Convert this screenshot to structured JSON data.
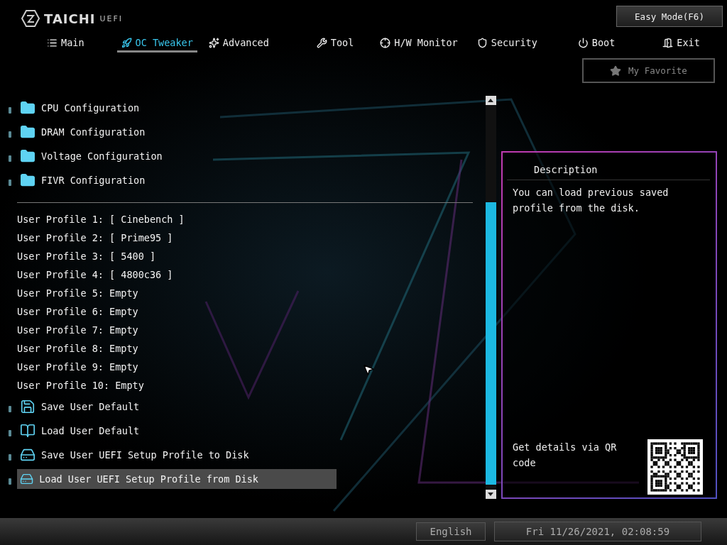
{
  "logo": {
    "brand": "TAICHI",
    "suffix": "UEFI"
  },
  "easy_mode_button": "Easy Mode(F6)",
  "tabs": [
    {
      "label": "Main",
      "kind": "list",
      "selected": false
    },
    {
      "label": "OC Tweaker",
      "kind": "rocket",
      "selected": true
    },
    {
      "label": "Advanced",
      "kind": "star",
      "selected": false
    },
    {
      "label": "Tool",
      "kind": "tools",
      "selected": false
    },
    {
      "label": "H/W Monitor",
      "kind": "crosshair",
      "selected": false
    },
    {
      "label": "Security",
      "kind": "shield",
      "selected": false
    },
    {
      "label": "Boot",
      "kind": "power",
      "selected": false
    },
    {
      "label": "Exit",
      "kind": "door",
      "selected": false
    }
  ],
  "favorite_button": "My Favorite",
  "menu_top": [
    {
      "label": "CPU Configuration",
      "kind": "folder",
      "selected": false
    },
    {
      "label": "DRAM Configuration",
      "kind": "folder",
      "selected": false
    },
    {
      "label": "Voltage Configuration",
      "kind": "folder",
      "selected": false
    },
    {
      "label": "FIVR Configuration",
      "kind": "folder",
      "selected": false
    }
  ],
  "profiles": [
    {
      "label": "User Profile 1: [ Cinebench ]"
    },
    {
      "label": "User Profile 2: [ Prime95 ]"
    },
    {
      "label": "User Profile 3: [ 5400 ]"
    },
    {
      "label": "User Profile 4: [ 4800c36 ]"
    },
    {
      "label": "User Profile 5: Empty"
    },
    {
      "label": "User Profile 6: Empty"
    },
    {
      "label": "User Profile 7: Empty"
    },
    {
      "label": "User Profile 8: Empty"
    },
    {
      "label": "User Profile 9: Empty"
    },
    {
      "label": "User Profile 10: Empty"
    }
  ],
  "menu_bottom": [
    {
      "label": "Save User Default",
      "kind": "save",
      "selected": false
    },
    {
      "label": "Load User Default",
      "kind": "book",
      "selected": false
    },
    {
      "label": "Save User UEFI Setup Profile to Disk",
      "kind": "disk",
      "selected": false
    },
    {
      "label": "Load User UEFI Setup Profile from Disk",
      "kind": "disk",
      "selected": true
    }
  ],
  "description": {
    "title": "Description",
    "text": "You can load previous saved profile from the disk.",
    "qr_hint": "Get details via QR code"
  },
  "status_bar": {
    "language": "English",
    "datetime": "Fri 11/26/2021, 02:08:59"
  }
}
